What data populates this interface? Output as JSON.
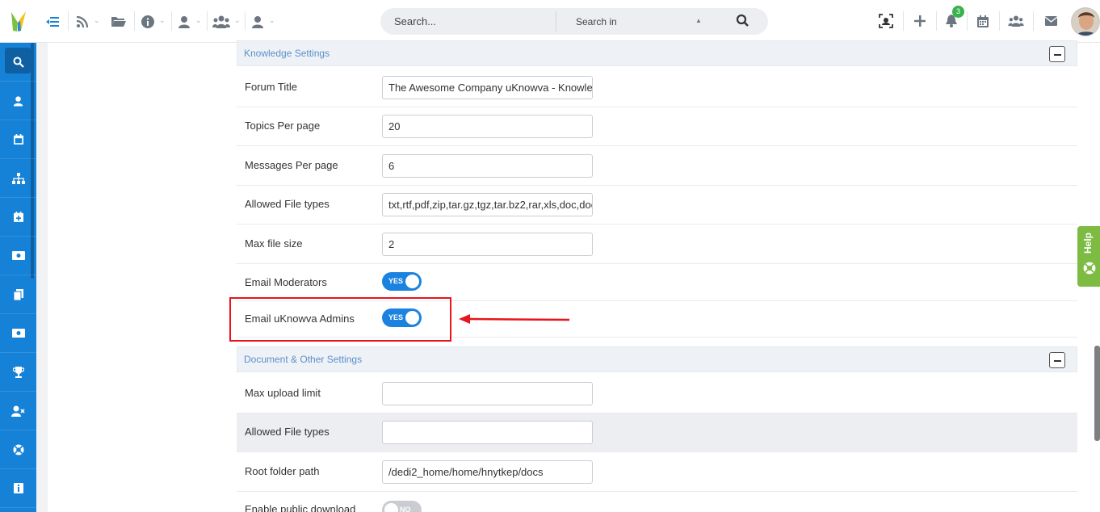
{
  "topbar": {
    "search_placeholder": "Search...",
    "search_in_label": "Search in",
    "notification_count": "3"
  },
  "sections": {
    "knowledge": {
      "title": "Knowledge Settings",
      "rows": {
        "forum_title": {
          "label": "Forum Title",
          "value": "The Awesome Company uKnowva - Knowled"
        },
        "topics_per_page": {
          "label": "Topics Per page",
          "value": "20"
        },
        "messages_per_page": {
          "label": "Messages Per page",
          "value": "6"
        },
        "allowed_file_types": {
          "label": "Allowed File types",
          "value": "txt,rtf,pdf,zip,tar.gz,tgz,tar.bz2,rar,xls,doc,doc"
        },
        "max_file_size": {
          "label": "Max file size",
          "value": "2"
        },
        "email_moderators": {
          "label": "Email Moderators",
          "toggle": "YES"
        },
        "email_admins": {
          "label": "Email uKnowva Admins",
          "toggle": "YES"
        }
      }
    },
    "document": {
      "title": "Document & Other Settings",
      "rows": {
        "max_upload_limit": {
          "label": "Max upload limit",
          "value": ""
        },
        "allowed_file_types": {
          "label": "Allowed File types",
          "value": ""
        },
        "root_folder_path": {
          "label": "Root folder path",
          "value": "/dedi2_home/home/hnytkep/docs"
        },
        "enable_public_download": {
          "label": "Enable public download",
          "toggle": "NO"
        }
      }
    }
  },
  "help_tab": {
    "label": "Help"
  },
  "colors": {
    "sidebar": "#1582d8",
    "toggle_on": "#1b82e0",
    "highlight": "#e8141c",
    "help": "#7dbb42",
    "section_title": "#5b8fc9"
  }
}
